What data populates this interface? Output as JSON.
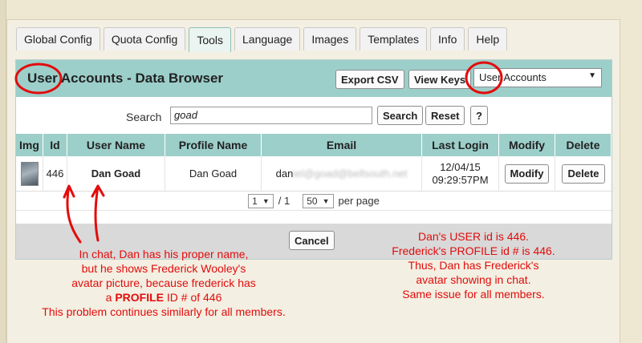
{
  "tabs": [
    "Global Config",
    "Quota Config",
    "Tools",
    "Language",
    "Images",
    "Templates",
    "Info",
    "Help"
  ],
  "active_tab": "Tools",
  "panel": {
    "title": "User Accounts - Data Browser",
    "export_label": "Export CSV",
    "view_keys_label": "View Keys",
    "select_value": "User Accounts"
  },
  "search": {
    "label": "Search",
    "value": "goad",
    "search_button": "Search",
    "reset_button": "Reset",
    "help_button": "?"
  },
  "table": {
    "columns": [
      "Img",
      "Id",
      "User Name",
      "Profile Name",
      "Email",
      "Last Login",
      "Modify",
      "Delete"
    ],
    "row": {
      "id": "446",
      "user_name": "Dan Goad",
      "profile_name": "Dan Goad",
      "email_visible": "dan",
      "email_blurred": "iel@goad@bellsouth.net",
      "last_login_date": "12/04/15",
      "last_login_time": "09:29:57PM",
      "modify_label": "Modify",
      "delete_label": "Delete"
    }
  },
  "pager": {
    "page_value": "1",
    "page_of": "/ 1",
    "per_page_value": "50",
    "per_page_label": "per page"
  },
  "cancel_label": "Cancel",
  "annotations": {
    "left": {
      "line1": "In chat, Dan has his proper name,",
      "line2": "but he shows Frederick Wooley's",
      "line3": "avatar picture, because frederick has",
      "line4_a": "a ",
      "line4_b": "PROFILE",
      "line4_c": " ID # of 446",
      "line5": "This problem continues similarly for all members."
    },
    "right": {
      "line1": "Dan's USER id is 446.",
      "line2": "Frederick's PROFILE id # is 446.",
      "line3": "Thus, Dan has Frederick's",
      "line4": "avatar showing in chat.",
      "line5": "Same issue for all members."
    }
  },
  "colors": {
    "annotation": "#e30c0c",
    "header_teal": "#9ccfca",
    "background": "#eee8d3"
  }
}
